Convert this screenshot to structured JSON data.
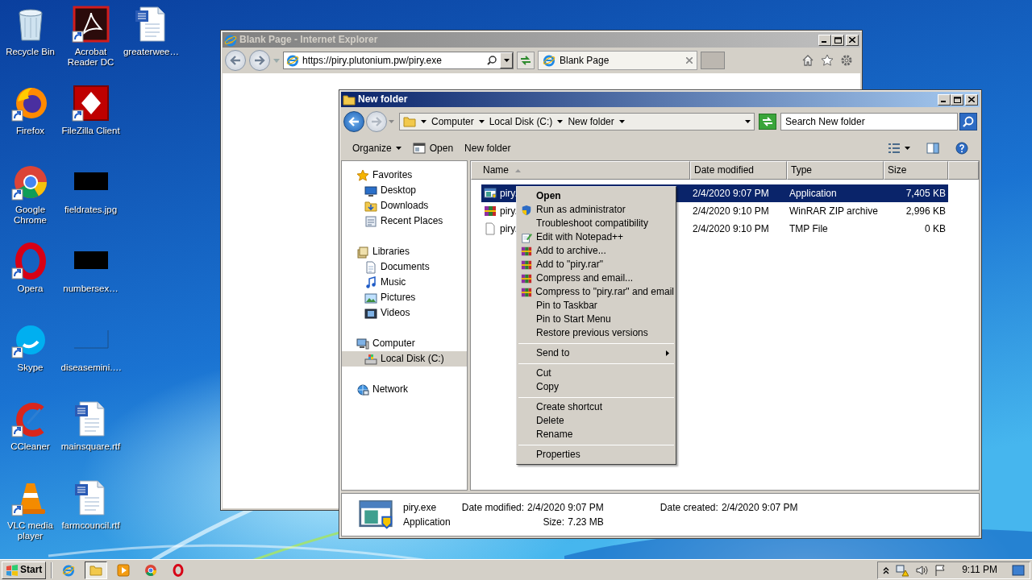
{
  "desktop_icons": [
    {
      "label": "Recycle Bin",
      "kind": "recycle-bin",
      "shortcut": false
    },
    {
      "label": "Firefox",
      "kind": "firefox",
      "shortcut": true
    },
    {
      "label": "Google Chrome",
      "kind": "chrome",
      "shortcut": true
    },
    {
      "label": "Opera",
      "kind": "opera",
      "shortcut": true
    },
    {
      "label": "Skype",
      "kind": "skype",
      "shortcut": true
    },
    {
      "label": "CCleaner",
      "kind": "ccleaner",
      "shortcut": true
    },
    {
      "label": "VLC media player",
      "kind": "vlc",
      "shortcut": true
    },
    {
      "label": "Acrobat Reader DC",
      "kind": "acrobat",
      "shortcut": true
    },
    {
      "label": "FileZilla Client",
      "kind": "filezilla",
      "shortcut": true
    },
    {
      "label": "fieldrates.jpg",
      "kind": "dark-thumbnail",
      "shortcut": false
    },
    {
      "label": "numbersex…",
      "kind": "dark-thumbnail",
      "shortcut": false
    },
    {
      "label": "diseasemini.…",
      "kind": "blank-thumbnail",
      "shortcut": false
    },
    {
      "label": "mainsquare.rtf",
      "kind": "word-doc",
      "shortcut": false
    },
    {
      "label": "farmcouncil.rtf",
      "kind": "word-doc",
      "shortcut": false
    },
    {
      "label": "greaterwee…",
      "kind": "word-doc",
      "shortcut": false
    }
  ],
  "browser_window": {
    "title": "Blank Page - Internet Explorer",
    "active": false,
    "address": "https://piry.plutonium.pw/piry.exe",
    "tabs": [
      {
        "label": "Blank Page",
        "selected": true
      }
    ]
  },
  "explorer_window": {
    "title": "New folder",
    "active": true,
    "breadcrumb": [
      "Computer",
      "Local Disk (C:)",
      "New folder"
    ],
    "search": {
      "placeholder": "Search New folder"
    },
    "toolbar": [
      {
        "label": "Organize",
        "kind": "menu"
      },
      {
        "label": "Open",
        "kind": "open"
      },
      {
        "label": "New folder",
        "kind": "plain"
      }
    ],
    "nav": [
      {
        "label": "Favorites",
        "kind": "star",
        "selected": false,
        "children": [
          {
            "label": "Desktop",
            "kind": "desktop",
            "selected": false
          },
          {
            "label": "Downloads",
            "kind": "downloads",
            "selected": false
          },
          {
            "label": "Recent Places",
            "kind": "recent",
            "selected": false
          }
        ]
      },
      {
        "label": "Libraries",
        "kind": "libraries",
        "selected": false,
        "children": [
          {
            "label": "Documents",
            "kind": "documents",
            "selected": false
          },
          {
            "label": "Music",
            "kind": "music",
            "selected": false
          },
          {
            "label": "Pictures",
            "kind": "pictures",
            "selected": false
          },
          {
            "label": "Videos",
            "kind": "videos",
            "selected": false
          }
        ]
      },
      {
        "label": "Computer",
        "kind": "computer",
        "selected": false,
        "children": [
          {
            "label": "Local Disk (C:)",
            "kind": "drive",
            "selected": true
          }
        ]
      },
      {
        "label": "Network",
        "kind": "network",
        "selected": false
      }
    ],
    "columns": [
      {
        "label": "Name",
        "sorted": true
      },
      {
        "label": "Date modified",
        "sorted": false
      },
      {
        "label": "Type",
        "sorted": false
      },
      {
        "label": "Size",
        "sorted": false
      }
    ],
    "rows": [
      {
        "name": "piry.",
        "date": "2/4/2020 9:07 PM",
        "type": "Application",
        "size": "7,405 KB",
        "kind": "exe",
        "selected": true
      },
      {
        "name": "piry.",
        "date": "2/4/2020 9:10 PM",
        "type": "WinRAR ZIP archive",
        "size": "2,996 KB",
        "kind": "rar",
        "selected": false
      },
      {
        "name": "piry.",
        "date": "2/4/2020 9:10 PM",
        "type": "TMP File",
        "size": "0 KB",
        "kind": "tmp",
        "selected": false
      }
    ],
    "details": {
      "name": "piry.exe",
      "type": "Application",
      "fields": [
        {
          "label": "Date modified:",
          "value": "2/4/2020 9:07 PM"
        },
        {
          "label": "Size:",
          "value": "7.23 MB"
        },
        {
          "label": "Date created:",
          "value": "2/4/2020 9:07 PM"
        }
      ]
    }
  },
  "context_menu": [
    {
      "kind": "item",
      "label": "Open",
      "default": true
    },
    {
      "kind": "shield",
      "label": "Run as administrator"
    },
    {
      "kind": "item",
      "label": "Troubleshoot compatibility"
    },
    {
      "kind": "notepad",
      "label": "Edit with Notepad++"
    },
    {
      "kind": "archive",
      "label": "Add to archive..."
    },
    {
      "kind": "archive",
      "label": "Add to \"piry.rar\""
    },
    {
      "kind": "archive",
      "label": "Compress and email..."
    },
    {
      "kind": "archive",
      "label": "Compress to \"piry.rar\" and email"
    },
    {
      "kind": "item",
      "label": "Pin to Taskbar"
    },
    {
      "kind": "item",
      "label": "Pin to Start Menu"
    },
    {
      "kind": "item",
      "label": "Restore previous versions"
    },
    {
      "kind": "separator"
    },
    {
      "kind": "item",
      "label": "Send to",
      "submenu": true
    },
    {
      "kind": "separator"
    },
    {
      "kind": "item",
      "label": "Cut"
    },
    {
      "kind": "item",
      "label": "Copy"
    },
    {
      "kind": "separator"
    },
    {
      "kind": "item",
      "label": "Create shortcut"
    },
    {
      "kind": "item",
      "label": "Delete"
    },
    {
      "kind": "item",
      "label": "Rename"
    },
    {
      "kind": "separator"
    },
    {
      "kind": "item",
      "label": "Properties"
    }
  ],
  "taskbar": {
    "start": "Start",
    "items": [
      {
        "kind": "ie",
        "selected": false
      },
      {
        "kind": "explorer",
        "selected": true
      },
      {
        "kind": "media",
        "selected": false
      },
      {
        "kind": "chrome",
        "selected": false
      },
      {
        "kind": "opera",
        "selected": false
      }
    ],
    "clock": "9:11 PM"
  }
}
